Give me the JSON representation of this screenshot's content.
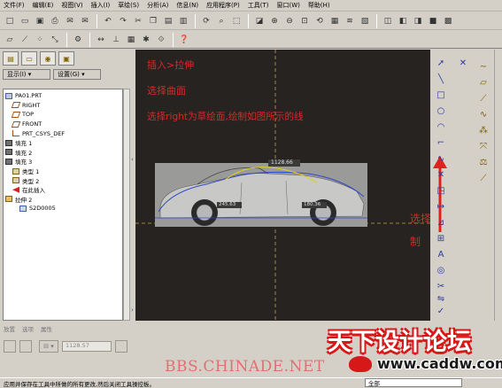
{
  "menu": [
    "文件(F)",
    "编辑(E)",
    "视图(V)",
    "插入(I)",
    "草绘(S)",
    "分析(A)",
    "信息(N)",
    "应用程序(P)",
    "工具(T)",
    "窗口(W)",
    "帮助(H)"
  ],
  "left_panel": {
    "display_dropdown": "显示(I) ▾",
    "settings_dropdown": "设置(G) ▾"
  },
  "tree": [
    {
      "label": "PA01.PRT",
      "icon": "part-icon",
      "indent": 0
    },
    {
      "label": "RIGHT",
      "icon": "datum-plane-icon",
      "indent": 1
    },
    {
      "label": "TOP",
      "icon": "datum-plane-icon",
      "indent": 1
    },
    {
      "label": "FRONT",
      "icon": "datum-plane-icon",
      "indent": 1
    },
    {
      "label": "PRT_CSYS_DEF",
      "icon": "csys-icon",
      "indent": 1
    },
    {
      "label": "填充 1",
      "icon": "fill-icon",
      "indent": 0
    },
    {
      "label": "填充 2",
      "icon": "fill-icon",
      "indent": 0
    },
    {
      "label": "填充 3",
      "icon": "fill-icon",
      "indent": 0
    },
    {
      "label": "类型 1",
      "icon": "type-icon",
      "indent": 1
    },
    {
      "label": "类型 2",
      "icon": "type-icon",
      "indent": 1
    },
    {
      "label": "在此插入",
      "icon": "insert-here-icon",
      "indent": 1
    },
    {
      "label": "拉伸 2",
      "icon": "extrude-icon",
      "indent": 0
    },
    {
      "label": "S2D0005",
      "icon": "sketch-icon",
      "indent": 2
    }
  ],
  "annotations": {
    "step1": "插入>拉伸",
    "step2": "选择曲面",
    "step3": "选择right为草绘面,绘制如图所示的线",
    "tool_hint": "选择这个工具绘制"
  },
  "dimensions": {
    "dim_top": "1128.66",
    "dim_left": "245.63",
    "dim_right": "180.36"
  },
  "bottom": {
    "tabs": [
      "放置",
      "选项",
      "属性"
    ],
    "depth_value": "1128.57",
    "status_text": "应用并保存在工具中所做的所有更改,然后关闭工具操控板。",
    "filter_value": "全部"
  },
  "watermark": {
    "bbs": "BBS.CHINADE.NET",
    "logo_top": "天下设计论坛",
    "logo_url": "www.caddw.com"
  },
  "colors": {
    "canvas_bg": "#262321",
    "annotation_red": "#d42a2a",
    "ui_gray": "#d4d0c8"
  }
}
